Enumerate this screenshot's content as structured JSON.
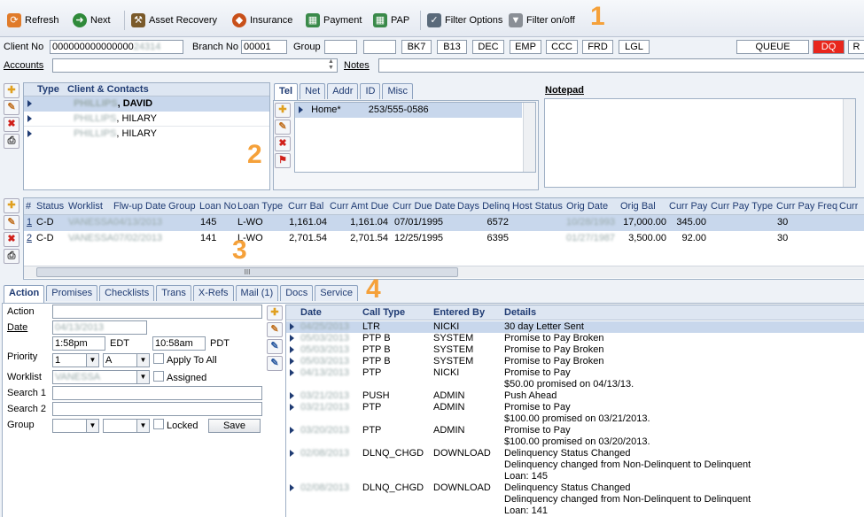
{
  "toolbar": {
    "refresh": "Refresh",
    "next": "Next",
    "asset_recovery": "Asset Recovery",
    "insurance": "Insurance",
    "payment": "Payment",
    "pap": "PAP",
    "filter_options": "Filter Options",
    "filter_onoff": "Filter on/off"
  },
  "callouts": [
    "1",
    "2",
    "3",
    "4"
  ],
  "header": {
    "client_no_label": "Client No",
    "client_no_value": "000000000000000",
    "branch_no_label": "Branch No",
    "branch_no_value": "00001",
    "group_label": "Group",
    "codes": [
      "BK7",
      "B13",
      "DEC",
      "EMP",
      "CCC",
      "FRD",
      "LGL"
    ],
    "queue": "QUEUE",
    "dq": "DQ",
    "r": "R",
    "accounts_label": "Accounts",
    "notes_label": "Notes"
  },
  "contacts": {
    "col_type": "Type",
    "col_client": "Client & Contacts",
    "rows": [
      {
        "blur": "PHILLIPS",
        "name": ", DAVID"
      },
      {
        "blur": "PHILLIPS",
        "name": ", HILARY"
      },
      {
        "blur": "PHILLIPS",
        "name": ", HILARY"
      }
    ]
  },
  "phone_tabs": [
    "Tel",
    "Net",
    "Addr",
    "ID",
    "Misc"
  ],
  "phone_row": {
    "type": "Home*",
    "number": "253/555-0586"
  },
  "notepad_label": "Notepad",
  "loans": {
    "columns": [
      "#",
      "Status",
      "Worklist",
      "Flw-up Date",
      "Group",
      "Loan No",
      "Loan Type",
      "Curr Bal",
      "Curr Amt Due",
      "Curr Due Date",
      "Days Delinq",
      "Host Status",
      "Orig Date",
      "Orig Bal",
      "Curr Pay",
      "Curr Pay Type",
      "Curr Pay Freq",
      "Curr"
    ],
    "rows": [
      {
        "num": "1",
        "status": "C-D",
        "worklist": "VANESSA",
        "flwup": "04/13/2013",
        "group": "",
        "loan_no": "145",
        "loan_type": "L-WO",
        "curr_bal": "1,161.04",
        "amt_due": "1,161.04",
        "due_date": "07/01/1995",
        "days": "6572",
        "host": "",
        "orig_date": "10/28/1993",
        "orig_bal": "17,000.00",
        "curr_pay": "345.00",
        "pay_type": "",
        "pay_freq": "30"
      },
      {
        "num": "2",
        "status": "C-D",
        "worklist": "VANESSA",
        "flwup": "07/02/2013",
        "group": "",
        "loan_no": "141",
        "loan_type": "L-WO",
        "curr_bal": "2,701.54",
        "amt_due": "2,701.54",
        "due_date": "12/25/1995",
        "days": "6395",
        "host": "",
        "orig_date": "01/27/1987",
        "orig_bal": "3,500.00",
        "curr_pay": "92.00",
        "pay_type": "",
        "pay_freq": "30"
      }
    ],
    "scroll_grip": "III"
  },
  "bottom_tabs": [
    "Action",
    "Promises",
    "Checklists",
    "Trans",
    "X-Refs",
    "Mail (1)",
    "Docs",
    "Service"
  ],
  "action": {
    "action_label": "Action",
    "date_label": "Date",
    "date_value": "04/13/2013",
    "time1": "1:58pm",
    "tz1": "EDT",
    "time2": "10:58am",
    "tz2": "PDT",
    "priority_label": "Priority",
    "priority_value": "1",
    "priority_letter": "A",
    "apply_all": "Apply To All",
    "worklist_label": "Worklist",
    "worklist_value": "VANESSA",
    "assigned": "Assigned",
    "search1": "Search 1",
    "search2": "Search 2",
    "group_label": "Group",
    "locked": "Locked",
    "save": "Save"
  },
  "history": {
    "columns": [
      "Date",
      "Call Type",
      "Entered By",
      "Details"
    ],
    "rows": [
      {
        "date": "04/25/2013",
        "type": "LTR",
        "by": "NICKI",
        "details": [
          "30 day Letter Sent"
        ]
      },
      {
        "date": "05/03/2013",
        "type": "PTP B",
        "by": "SYSTEM",
        "details": [
          "Promise to Pay Broken"
        ]
      },
      {
        "date": "05/03/2013",
        "type": "PTP B",
        "by": "SYSTEM",
        "details": [
          "Promise to Pay Broken"
        ]
      },
      {
        "date": "05/03/2013",
        "type": "PTP B",
        "by": "SYSTEM",
        "details": [
          "Promise to Pay Broken"
        ]
      },
      {
        "date": "04/13/2013",
        "type": "PTP",
        "by": "NICKI",
        "details": [
          "Promise to Pay",
          "$50.00 promised on 04/13/13."
        ]
      },
      {
        "date": "03/21/2013",
        "type": "PUSH",
        "by": "ADMIN",
        "details": [
          "Push Ahead"
        ]
      },
      {
        "date": "03/21/2013",
        "type": "PTP",
        "by": "ADMIN",
        "details": [
          "Promise to Pay",
          "$100.00 promised on 03/21/2013."
        ]
      },
      {
        "date": "03/20/2013",
        "type": "PTP",
        "by": "ADMIN",
        "details": [
          "Promise to Pay",
          "$100.00 promised on 03/20/2013."
        ]
      },
      {
        "date": "02/08/2013",
        "type": "DLNQ_CHGD",
        "by": "DOWNLOAD",
        "details": [
          "Delinquency Status Changed",
          "Delinquency changed from Non-Delinquent to Delinquent",
          "Loan: 145"
        ]
      },
      {
        "date": "02/08/2013",
        "type": "DLNQ_CHGD",
        "by": "DOWNLOAD",
        "details": [
          "Delinquency Status Changed",
          "Delinquency changed from Non-Delinquent to Delinquent",
          "Loan: 141"
        ]
      }
    ]
  },
  "colors": {
    "accent": "#f5a13a",
    "dq": "#e8261c",
    "header_blue": "#1f3b73",
    "selected_row": "#c8d7ec"
  }
}
